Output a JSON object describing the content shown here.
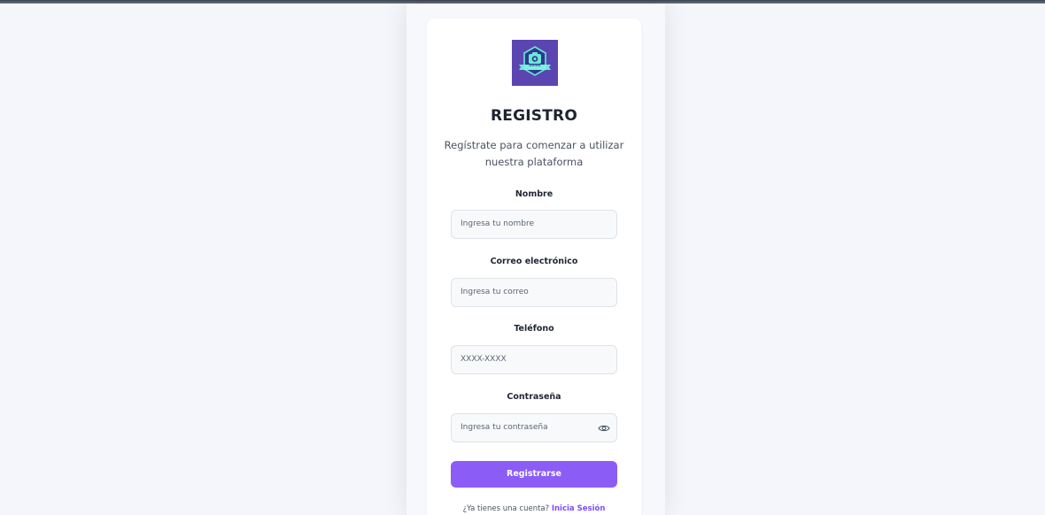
{
  "page": {
    "title": "REGISTRO",
    "subtitle": "Regístrate para comenzar a utilizar nuestra plataforma"
  },
  "logo": {
    "text": "OVIOS",
    "icon": "camera-icon",
    "color": "#5b46b1"
  },
  "form": {
    "name": {
      "label": "Nombre",
      "placeholder": "Ingresa tu nombre"
    },
    "email": {
      "label": "Correo electrónico",
      "placeholder": "Ingresa tu correo"
    },
    "phone": {
      "label": "Teléfono",
      "placeholder": "XXXX-XXXX"
    },
    "password": {
      "label": "Contraseña",
      "placeholder": "Ingresa tu contraseña",
      "toggle_icon": "eye-icon"
    },
    "submit_label": "Registrarse"
  },
  "footer": {
    "prompt": "¿Ya tienes una cuenta?",
    "login_link": "Inicia Sesión"
  },
  "colors": {
    "accent": "#8b5cf6",
    "link": "#7c4dff",
    "background": "#f5f6fb",
    "card": "#ffffff"
  }
}
